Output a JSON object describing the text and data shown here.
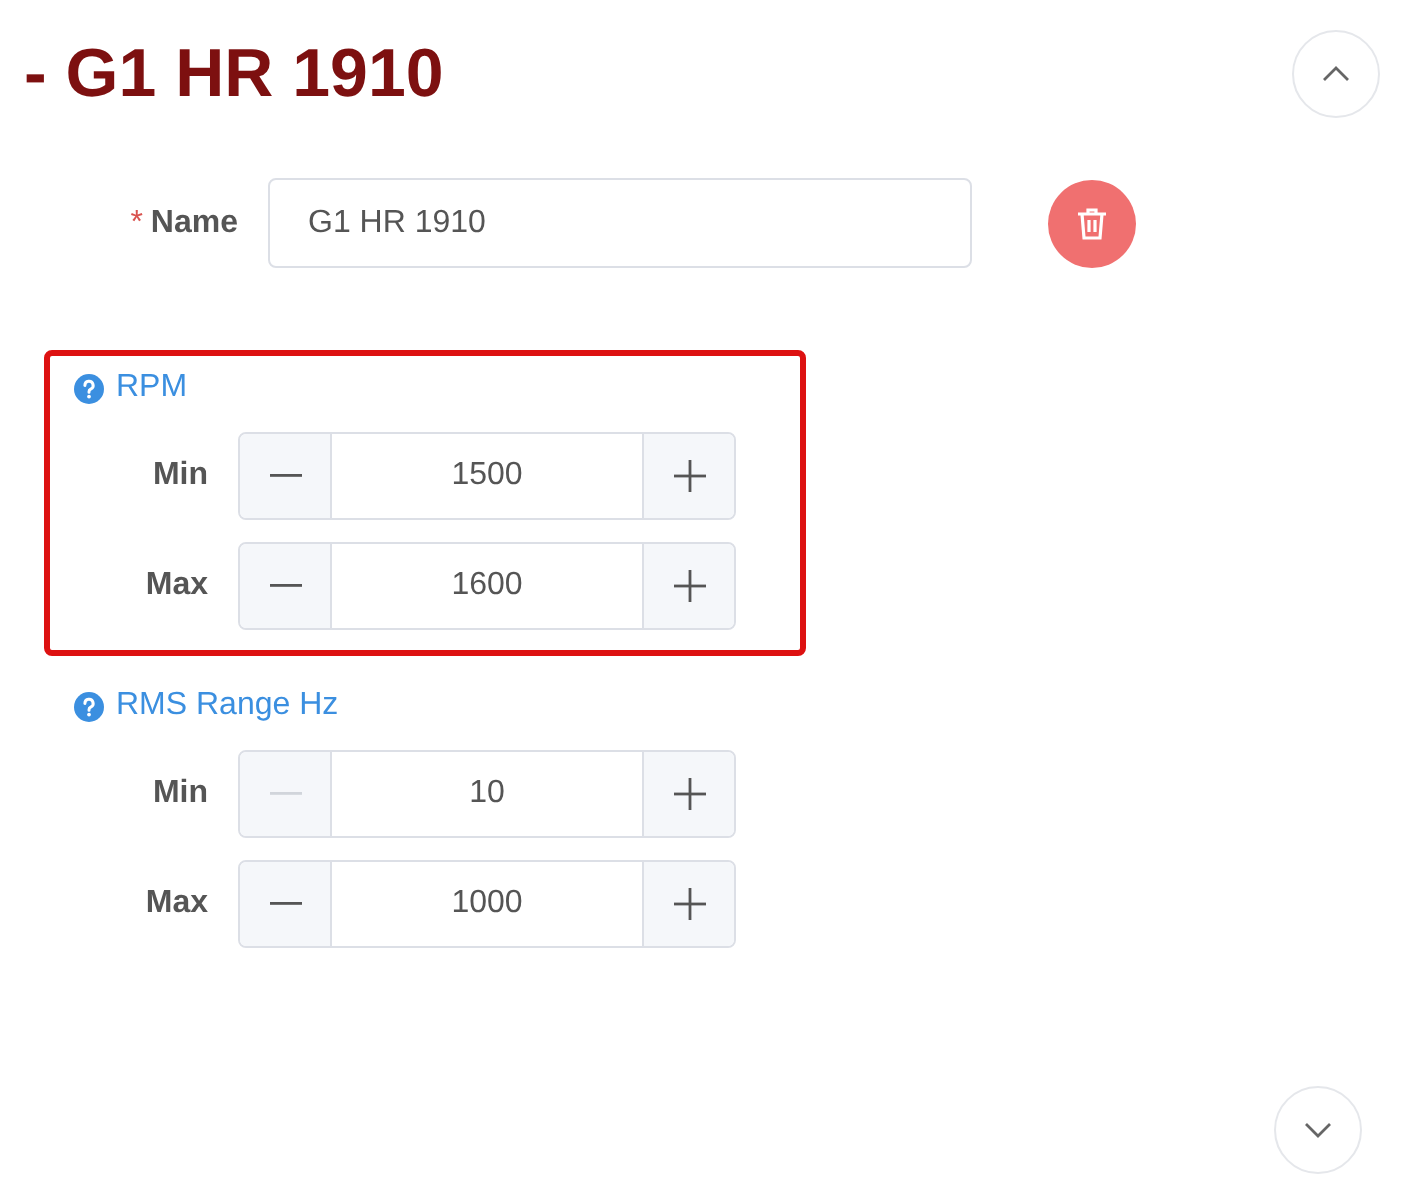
{
  "title": "- G1 HR 1910",
  "name_field": {
    "required_mark": "*",
    "label": "Name",
    "value": "G1 HR 1910"
  },
  "groups": [
    {
      "label": "RPM",
      "highlighted": true,
      "rows": [
        {
          "label": "Min",
          "value": "1500",
          "decrement_disabled": false
        },
        {
          "label": "Max",
          "value": "1600",
          "decrement_disabled": false
        }
      ]
    },
    {
      "label": "RMS Range Hz",
      "highlighted": false,
      "rows": [
        {
          "label": "Min",
          "value": "10",
          "decrement_disabled": true
        },
        {
          "label": "Max",
          "value": "1000",
          "decrement_disabled": false
        }
      ]
    }
  ]
}
